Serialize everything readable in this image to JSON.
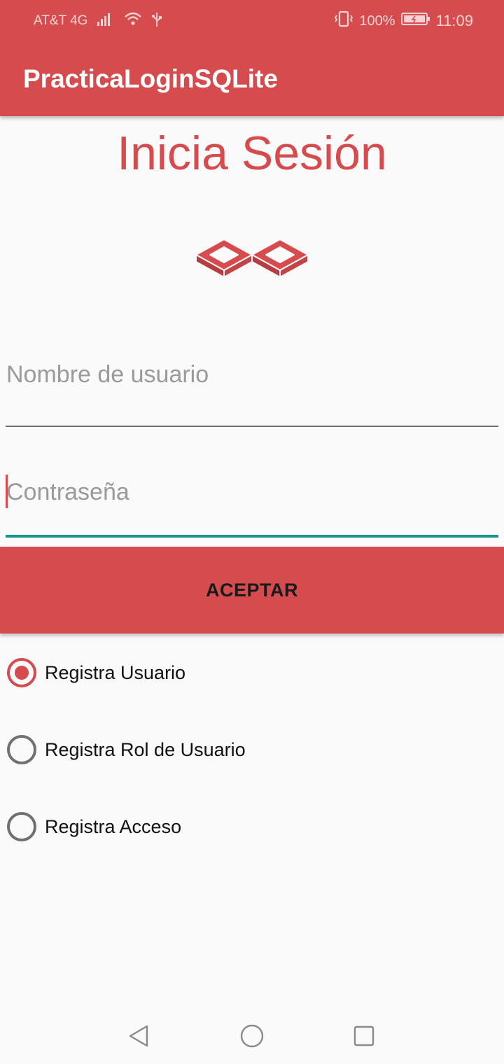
{
  "status_bar": {
    "carrier": "AT&T 4G",
    "battery_percent": "100%",
    "time": "11:09"
  },
  "app_bar": {
    "title": "PracticaLoginSQLite"
  },
  "login": {
    "heading": "Inicia Sesión",
    "username_placeholder": "Nombre de usuario",
    "password_placeholder": "Contraseña",
    "accept_label": "ACEPTAR"
  },
  "options": [
    {
      "label": "Registra Usuario",
      "checked": true
    },
    {
      "label": "Registra Rol de Usuario",
      "checked": false
    },
    {
      "label": "Registra Acceso",
      "checked": false
    }
  ],
  "colors": {
    "primary": "#d64c4e",
    "accent": "#17968a"
  },
  "icons": [
    "signal-icon",
    "wifi-icon",
    "usb-icon",
    "vibrate-icon",
    "battery-icon",
    "infinity-logo-icon",
    "back-icon",
    "home-icon",
    "recent-apps-icon"
  ]
}
